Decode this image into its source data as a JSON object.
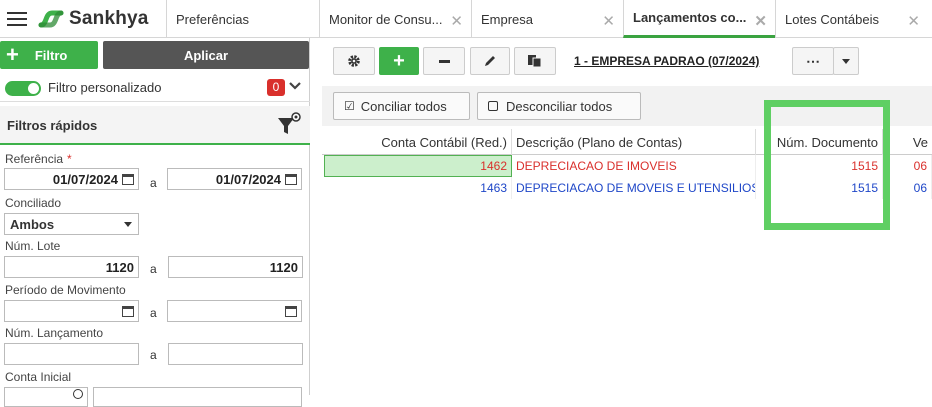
{
  "topbar": {
    "brand": "Sankhya",
    "tabs": [
      {
        "label": "Preferências",
        "active": false
      },
      {
        "label": "Monitor de Consu...",
        "active": false
      },
      {
        "label": "Empresa",
        "active": false
      },
      {
        "label": "Lançamentos co...",
        "active": true
      },
      {
        "label": "Lotes Contábeis",
        "active": false
      }
    ]
  },
  "left_panel": {
    "filtro_button": "Filtro",
    "aplicar_button": "Aplicar",
    "filtro_personalizado": "Filtro personalizado",
    "filtro_count": "0",
    "filtros_rapidos": "Filtros rápidos",
    "referencia_label": "Referência",
    "referencia_from": "01/07/2024",
    "referencia_to": "01/07/2024",
    "a_sep": "a",
    "conciliado_label": "Conciliado",
    "conciliado_value": "Ambos",
    "num_lote_label": "Núm. Lote",
    "num_lote_from": "1120",
    "num_lote_to": "1120",
    "periodo_label": "Período de Movimento",
    "periodo_from": "",
    "periodo_to": "",
    "num_lancamento_label": "Núm. Lançamento",
    "num_lancamento_from": "",
    "num_lancamento_to": "",
    "conta_inicial_label": "Conta Inicial"
  },
  "main": {
    "empresa": "1 - EMPRESA PADRAO (07/2024)",
    "more_label": "⋯",
    "conciliar_todos": "Conciliar todos",
    "desconciliar_todos": "Desconciliar todos",
    "columns": [
      "Conta Contábil (Red.)",
      "Descrição (Plano de Contas)",
      "Núm. Documento",
      "Ve"
    ],
    "rows": [
      {
        "conta": "1462",
        "descricao": "DEPRECIACAO DE IMOVEIS",
        "num_documento": "1515",
        "ve": "06",
        "color": "#d9302c"
      },
      {
        "conta": "1463",
        "descricao": "DEPRECIACAO DE MOVEIS E UTENSILIOS",
        "num_documento": "1515",
        "ve": "06",
        "color": "#1f47c8"
      }
    ]
  },
  "colors": {
    "accent_green": "#3eb14a",
    "highlight_green": "#5fcf63",
    "badge_red": "#d9302c",
    "dark_button": "#555555"
  }
}
